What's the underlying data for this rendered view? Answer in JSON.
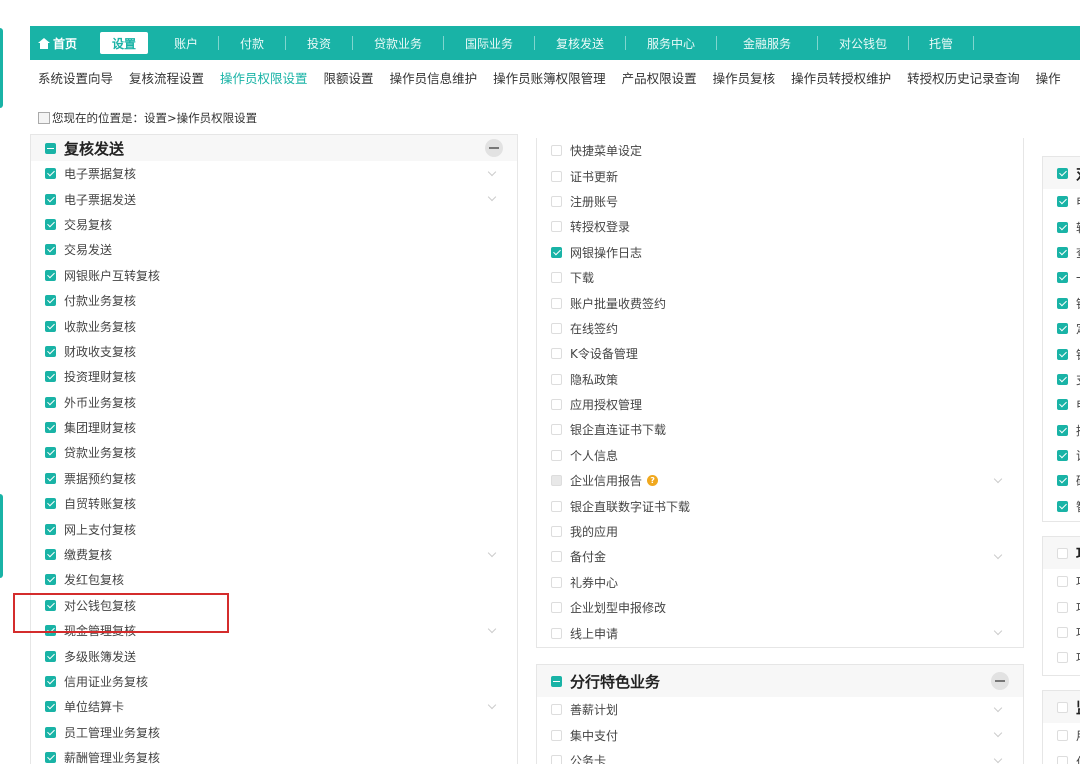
{
  "topnav": {
    "home": "首页",
    "items": [
      "设置",
      "账户",
      "付款",
      "投资",
      "贷款业务",
      "国际业务",
      "复核发送",
      "服务中心",
      "金融服务",
      "对公钱包",
      "托管"
    ]
  },
  "subnav": {
    "items": [
      "系统设置向导",
      "复核流程设置",
      "操作员权限设置",
      "限额设置",
      "操作员信息维护",
      "操作员账簿权限管理",
      "产品权限设置",
      "操作员复核",
      "操作员转授权维护",
      "转授权历史记录查询",
      "操作"
    ]
  },
  "breadcrumb": {
    "text": "您现在的位置是：设置>操作员权限设置"
  },
  "left_panel": {
    "title": "复核发送",
    "rows": [
      {
        "label": "电子票据复核"
      },
      {
        "label": "电子票据发送"
      },
      {
        "label": "交易复核"
      },
      {
        "label": "交易发送"
      },
      {
        "label": "网银账户互转复核"
      },
      {
        "label": "付款业务复核"
      },
      {
        "label": "收款业务复核"
      },
      {
        "label": "财政收支复核"
      },
      {
        "label": "投资理财复核"
      },
      {
        "label": "外币业务复核"
      },
      {
        "label": "集团理财复核"
      },
      {
        "label": "贷款业务复核"
      },
      {
        "label": "票据预约复核"
      },
      {
        "label": "自贸转账复核"
      },
      {
        "label": "网上支付复核"
      },
      {
        "label": "缴费复核"
      },
      {
        "label": "发红包复核"
      },
      {
        "label": "对公钱包复核"
      },
      {
        "label": "现金管理复核"
      },
      {
        "label": "多级账簿发送"
      },
      {
        "label": "信用证业务复核"
      },
      {
        "label": "单位结算卡"
      },
      {
        "label": "员工管理业务复核"
      },
      {
        "label": "薪酬管理业务复核"
      }
    ]
  },
  "middle_panel": {
    "rows": [
      {
        "label": "快捷菜单设定"
      },
      {
        "label": "证书更新"
      },
      {
        "label": "注册账号"
      },
      {
        "label": "转授权登录"
      },
      {
        "label": "网银操作日志"
      },
      {
        "label": "下载"
      },
      {
        "label": "账户批量收费签约"
      },
      {
        "label": "在线签约"
      },
      {
        "label": "K令设备管理"
      },
      {
        "label": "隐私政策"
      },
      {
        "label": "应用授权管理"
      },
      {
        "label": "银企直连证书下载"
      },
      {
        "label": "个人信息"
      },
      {
        "label": "企业信用报告"
      },
      {
        "label": "银企直联数字证书下载"
      },
      {
        "label": "我的应用"
      },
      {
        "label": "备付金"
      },
      {
        "label": "礼券中心"
      },
      {
        "label": "企业划型申报修改"
      },
      {
        "label": "线上申请"
      }
    ]
  },
  "branch_panel": {
    "title": "分行特色业务",
    "rows": [
      {
        "label": "善薪计划"
      },
      {
        "label": "集中支付"
      },
      {
        "label": "公务卡"
      }
    ]
  },
  "right_panel": {
    "title": "对",
    "rows": [
      {
        "label": "电"
      },
      {
        "label": "转"
      },
      {
        "label": "查"
      },
      {
        "label": "一"
      },
      {
        "label": "银"
      },
      {
        "label": "定"
      },
      {
        "label": "银"
      },
      {
        "label": "支"
      },
      {
        "label": "电"
      },
      {
        "label": "授"
      },
      {
        "label": "证"
      },
      {
        "label": "硬"
      },
      {
        "label": "智"
      }
    ]
  },
  "right_panel2": {
    "title": "项",
    "rows": [
      {
        "label": "项"
      },
      {
        "label": "项"
      },
      {
        "label": "项"
      },
      {
        "label": "项"
      }
    ]
  },
  "right_panel3": {
    "title": "监",
    "rows": [
      {
        "label": "用"
      },
      {
        "label": "付"
      }
    ]
  },
  "colors": {
    "accent": "#19b3a6",
    "highlight": "#d42c2c"
  }
}
